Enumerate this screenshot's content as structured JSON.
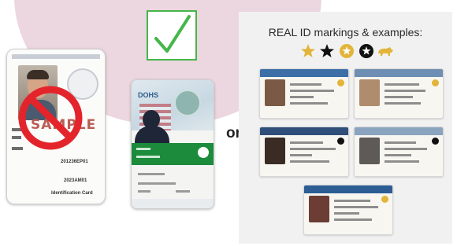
{
  "panel": {
    "title": "REAL ID markings & examples:"
  },
  "connector": {
    "or_label": "or"
  },
  "left_card": {
    "watermark": "SAMPLE",
    "label_a": "201236EP01",
    "label_b": "2023AM01",
    "footer": "Identification Card"
  },
  "middle_card": {
    "logo": "DOHS"
  },
  "icons": {
    "prohibited": "prohibited-icon",
    "check": "checkmark-icon",
    "markers": [
      "gold-star-icon",
      "black-star-icon",
      "gold-circle-star-icon",
      "black-circle-star-icon",
      "bear-icon"
    ]
  },
  "colors": {
    "blob": "#ecd6df",
    "check_green": "#45b649",
    "no_red": "#e4242b",
    "marker_gold": "#e2b53a",
    "panel_bg": "#f1f1f1"
  }
}
